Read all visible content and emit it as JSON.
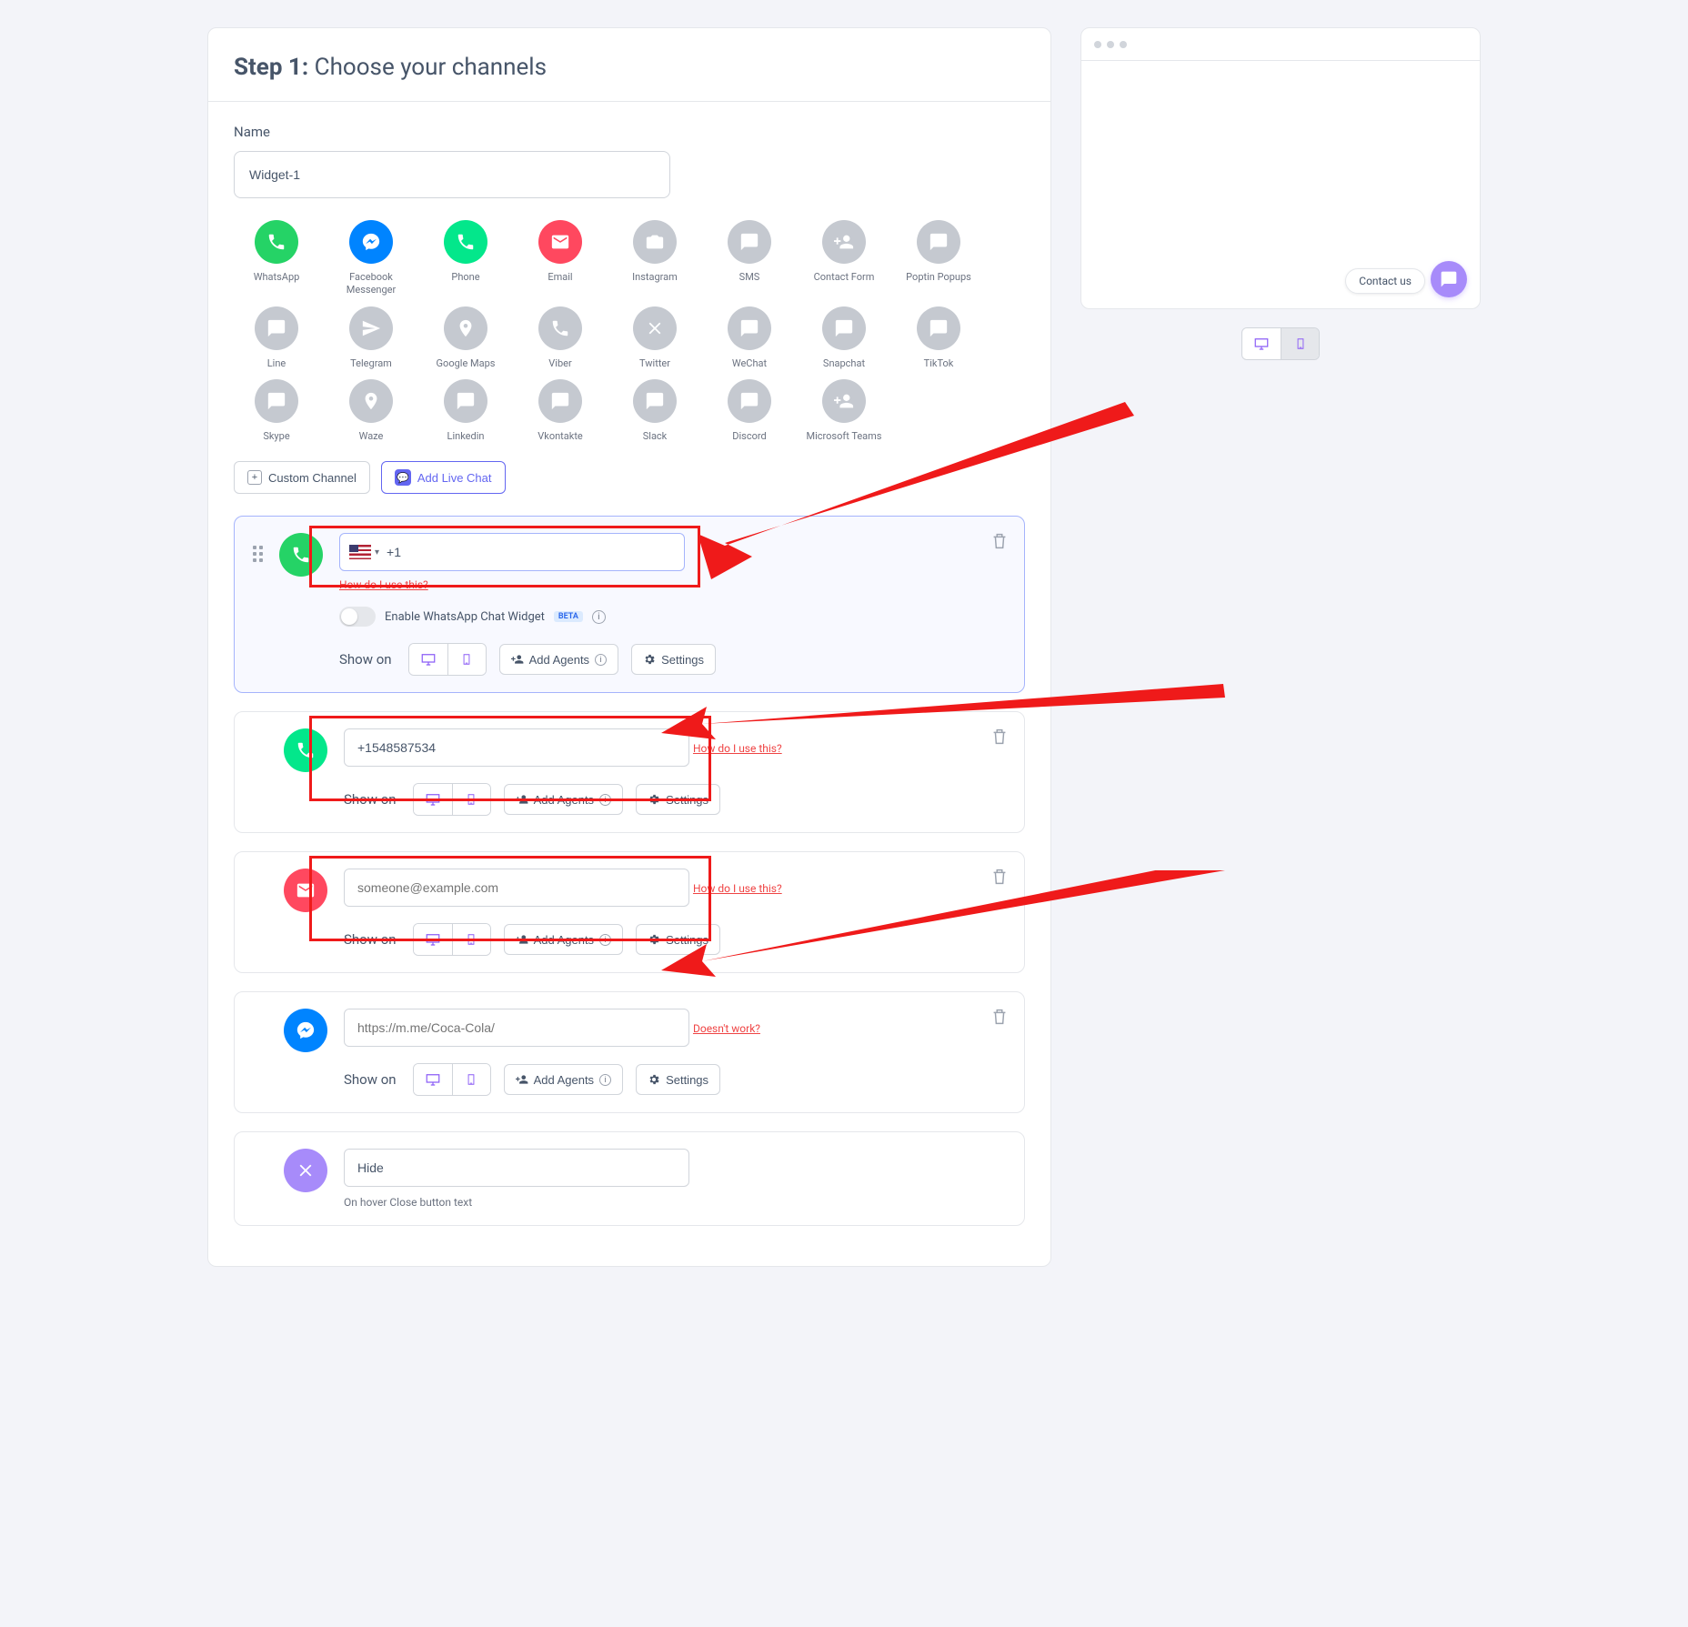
{
  "step": {
    "prefix": "Step 1:",
    "title": "Choose your channels"
  },
  "nameField": {
    "label": "Name",
    "value": "Widget-1"
  },
  "channels": [
    {
      "id": "whatsapp",
      "label": "WhatsApp",
      "bg": "bg-whatsapp",
      "glyph": "phone"
    },
    {
      "id": "messenger",
      "label": "Facebook Messenger",
      "bg": "bg-messenger",
      "glyph": "messenger"
    },
    {
      "id": "phone",
      "label": "Phone",
      "bg": "bg-phone",
      "glyph": "phone"
    },
    {
      "id": "email",
      "label": "Email",
      "bg": "bg-email",
      "glyph": "email"
    },
    {
      "id": "instagram",
      "label": "Instagram",
      "bg": "bg-grey",
      "glyph": "instagram"
    },
    {
      "id": "sms",
      "label": "SMS",
      "bg": "bg-grey",
      "glyph": "sms"
    },
    {
      "id": "contactform",
      "label": "Contact Form",
      "bg": "bg-grey",
      "glyph": "contact"
    },
    {
      "id": "poptin",
      "label": "Poptin Popups",
      "bg": "bg-grey",
      "glyph": "poptin"
    },
    {
      "id": "line",
      "label": "Line",
      "bg": "bg-grey",
      "glyph": "line"
    },
    {
      "id": "telegram",
      "label": "Telegram",
      "bg": "bg-grey",
      "glyph": "telegram"
    },
    {
      "id": "gmaps",
      "label": "Google Maps",
      "bg": "bg-grey",
      "glyph": "pin"
    },
    {
      "id": "viber",
      "label": "Viber",
      "bg": "bg-grey",
      "glyph": "viber"
    },
    {
      "id": "twitter",
      "label": "Twitter",
      "bg": "bg-grey",
      "glyph": "twitter"
    },
    {
      "id": "wechat",
      "label": "WeChat",
      "bg": "bg-grey",
      "glyph": "wechat"
    },
    {
      "id": "snapchat",
      "label": "Snapchat",
      "bg": "bg-grey",
      "glyph": "snapchat"
    },
    {
      "id": "tiktok",
      "label": "TikTok",
      "bg": "bg-grey",
      "glyph": "tiktok"
    },
    {
      "id": "skype",
      "label": "Skype",
      "bg": "bg-grey",
      "glyph": "skype"
    },
    {
      "id": "waze",
      "label": "Waze",
      "bg": "bg-grey",
      "glyph": "waze"
    },
    {
      "id": "linkedin",
      "label": "Linkedin",
      "bg": "bg-grey",
      "glyph": "linkedin"
    },
    {
      "id": "vkontakte",
      "label": "Vkontakte",
      "bg": "bg-grey",
      "glyph": "vk"
    },
    {
      "id": "slack",
      "label": "Slack",
      "bg": "bg-grey",
      "glyph": "slack"
    },
    {
      "id": "discord",
      "label": "Discord",
      "bg": "bg-grey",
      "glyph": "discord"
    },
    {
      "id": "teams",
      "label": "Microsoft Teams",
      "bg": "bg-grey",
      "glyph": "teams"
    }
  ],
  "customChannelBtn": "Custom Channel",
  "addLiveChatBtn": "Add Live Chat",
  "cards": {
    "whatsapp": {
      "prefix": "+1",
      "help": "How do I use this?",
      "toggle": "Enable WhatsApp Chat Widget",
      "beta": "BETA"
    },
    "phone": {
      "value": "+1548587534",
      "help": "How do I use this?"
    },
    "email": {
      "placeholder": "someone@example.com",
      "help": "How do I use this?"
    },
    "messenger": {
      "placeholder": "https://m.me/Coca-Cola/",
      "help": "Doesn't work?"
    },
    "close": {
      "value": "Hide",
      "hint": "On hover Close button text"
    }
  },
  "controls": {
    "showOn": "Show on",
    "addAgents": "Add Agents",
    "settings": "Settings"
  },
  "preview": {
    "contactUs": "Contact us"
  }
}
